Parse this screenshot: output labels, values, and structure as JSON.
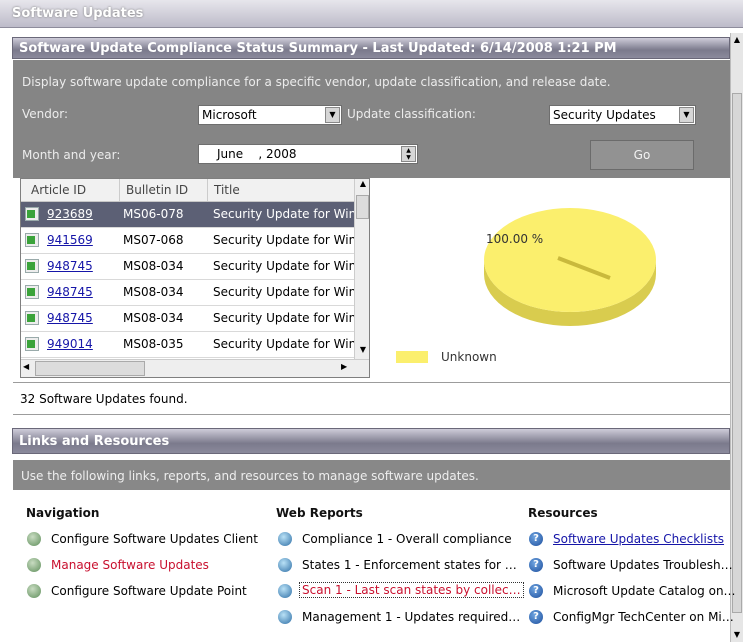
{
  "window": {
    "title": "Software Updates"
  },
  "summary": {
    "header": "Software Update Compliance Status Summary - Last Updated: 6/14/2008 1:21 PM",
    "description": "Display software update compliance for a specific vendor, update classification, and release date.",
    "vendor_label": "Vendor:",
    "vendor_value": "Microsoft",
    "classification_label": "Update classification:",
    "classification_value": "Security Updates",
    "month_label": "Month and year:",
    "month_value": "June    , 2008",
    "go_label": "Go"
  },
  "grid": {
    "columns": [
      "Article ID",
      "Bulletin ID",
      "Title"
    ],
    "rows": [
      {
        "article": "923689",
        "bulletin": "MS06-078",
        "title": "Security Update for Win"
      },
      {
        "article": "941569",
        "bulletin": "MS07-068",
        "title": "Security Update for Win"
      },
      {
        "article": "948745",
        "bulletin": "MS08-034",
        "title": "Security Update for Win"
      },
      {
        "article": "948745",
        "bulletin": "MS08-034",
        "title": "Security Update for Win"
      },
      {
        "article": "948745",
        "bulletin": "MS08-034",
        "title": "Security Update for Win"
      },
      {
        "article": "949014",
        "bulletin": "MS08-035",
        "title": "Security Update for Win"
      }
    ],
    "found_text": "32 Software Updates found."
  },
  "chart_data": {
    "type": "pie",
    "slices": [
      {
        "label": "Unknown",
        "value": 100.0,
        "color": "#fbef6d"
      }
    ],
    "data_labels": [
      "100.00 %"
    ],
    "legend": [
      "Unknown"
    ],
    "legend_placement": "bottom-left"
  },
  "links": {
    "header": "Links and Resources",
    "description": "Use the following links, reports, and resources to manage software updates.",
    "navigation_title": "Navigation",
    "navigation": [
      "Configure Software Updates Client",
      "Manage Software Updates",
      "Configure Software Update Point"
    ],
    "web_reports_title": "Web Reports",
    "web_reports": [
      "Compliance 1 - Overall compliance",
      "States 1 - Enforcement states for …",
      "Scan 1 - Last scan states by collec…",
      "Management 1 - Updates required…"
    ],
    "resources_title": "Resources",
    "resources": [
      "Software Updates Checklists",
      "Software Updates Troublesh…",
      "Microsoft Update Catalog on…",
      "ConfigMgr TechCenter on Mi…"
    ]
  },
  "colors": {
    "header_gradient_dark": "#7b7a8c",
    "panel_grey": "#858585",
    "selected_row": "#5c6075",
    "link_red": "#c8102e",
    "pie_yellow": "#fbef6d"
  }
}
